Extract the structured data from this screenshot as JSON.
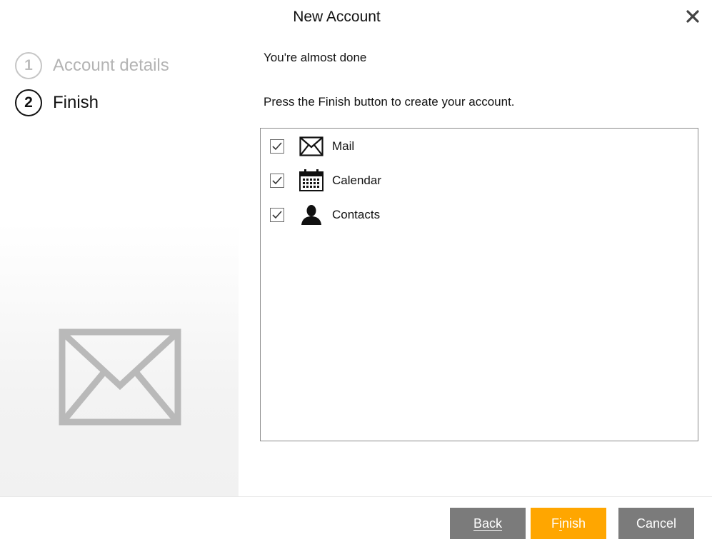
{
  "window": {
    "title": "New Account"
  },
  "steps": [
    {
      "number": "1",
      "label": "Account details",
      "state": "inactive"
    },
    {
      "number": "2",
      "label": "Finish",
      "state": "active"
    }
  ],
  "main": {
    "heading": "You're almost done",
    "instruction": "Press the Finish button to create your account."
  },
  "services": [
    {
      "label": "Mail",
      "checked": true,
      "icon": "envelope-icon"
    },
    {
      "label": "Calendar",
      "checked": true,
      "icon": "calendar-icon"
    },
    {
      "label": "Contacts",
      "checked": true,
      "icon": "person-icon"
    }
  ],
  "buttons": {
    "back": {
      "label": "Back",
      "mnemonic": "B"
    },
    "finish": {
      "label": "Finish",
      "mnemonic": "i"
    },
    "cancel": {
      "label": "Cancel"
    }
  },
  "colors": {
    "accent": "#ffa600",
    "button_gray": "#7b7b7b",
    "inactive_text": "#b4b4b4"
  }
}
